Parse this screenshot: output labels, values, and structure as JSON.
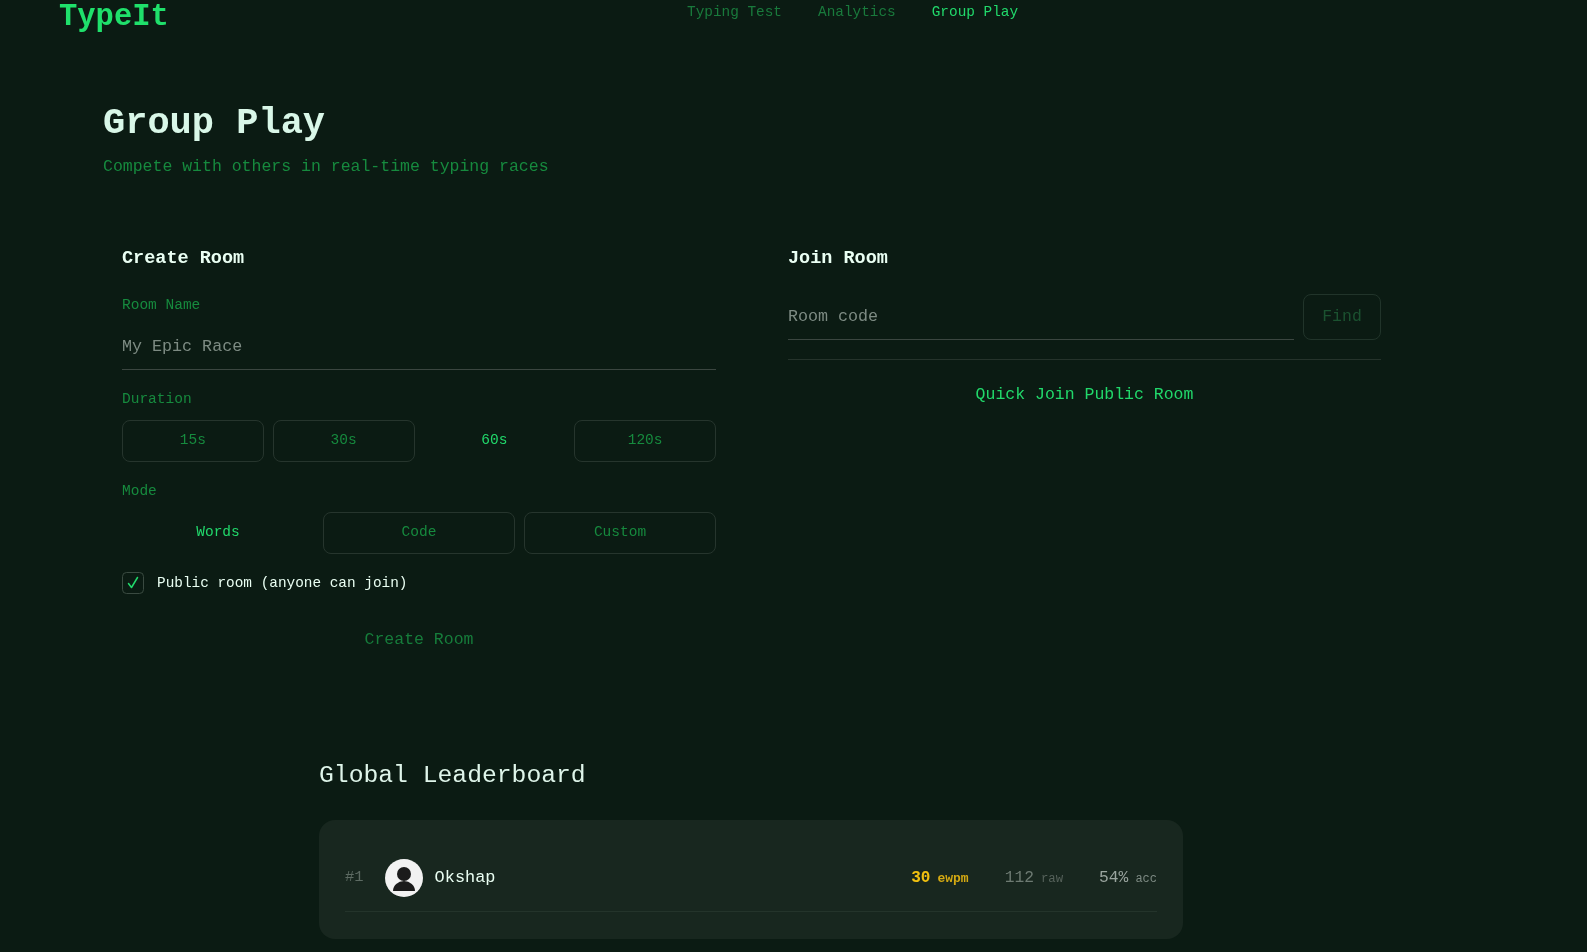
{
  "header": {
    "logo": "TypeIt",
    "nav": [
      {
        "label": "Typing Test",
        "selected": false
      },
      {
        "label": "Analytics",
        "selected": false
      },
      {
        "label": "Group Play",
        "selected": true
      }
    ]
  },
  "page": {
    "title": "Group Play",
    "subtitle": "Compete with others in real-time typing races"
  },
  "create_room": {
    "heading": "Create Room",
    "room_name": {
      "label": "Room Name",
      "placeholder": "My Epic Race"
    },
    "duration": {
      "label": "Duration",
      "options": [
        {
          "label": "15s",
          "selected": false
        },
        {
          "label": "30s",
          "selected": false
        },
        {
          "label": "60s",
          "selected": true
        },
        {
          "label": "120s",
          "selected": false
        }
      ]
    },
    "mode": {
      "label": "Mode",
      "options": [
        {
          "label": "Words",
          "selected": true
        },
        {
          "label": "Code",
          "selected": false
        },
        {
          "label": "Custom",
          "selected": false
        }
      ]
    },
    "public_room": {
      "label": "Public room (anyone can join)",
      "checked": true
    },
    "submit": {
      "label": "Create Room",
      "disabled": true
    }
  },
  "join_room": {
    "heading": "Join Room",
    "room_code": {
      "placeholder": "Room code"
    },
    "find_button": {
      "label": "Find",
      "disabled": true
    },
    "quick_join": "Quick Join Public Room"
  },
  "leaderboard": {
    "title": "Global Leaderboard",
    "rows": [
      {
        "rank": "#1",
        "name": "Okshap",
        "stats": [
          {
            "kind": "ewpm",
            "value": "30",
            "unit": "ewpm"
          },
          {
            "kind": "raw",
            "value": "112",
            "unit": "raw"
          },
          {
            "kind": "acc",
            "value": "54%",
            "unit": "acc"
          }
        ]
      }
    ]
  }
}
